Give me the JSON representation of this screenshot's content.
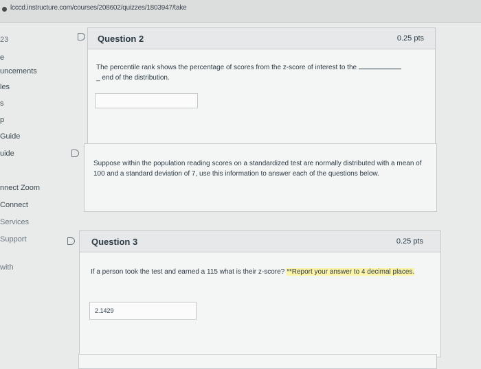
{
  "browser": {
    "url": "lcccd.instructure.com/courses/208602/quizzes/1803947/take"
  },
  "sidebar": {
    "items": [
      {
        "label": "23"
      },
      {
        "label": "e"
      },
      {
        "label": "uncements"
      },
      {
        "label": "les"
      },
      {
        "label": "s"
      },
      {
        "label": "p"
      },
      {
        "label": "Guide"
      },
      {
        "label": "uide"
      },
      {
        "label": "nnect Zoom"
      },
      {
        "label": "Connect"
      },
      {
        "label": "Services"
      },
      {
        "label": "Support"
      },
      {
        "label": "with"
      }
    ]
  },
  "questions": {
    "q2": {
      "title": "Question 2",
      "points": "0.25 pts",
      "text_before": "The percentile rank shows the percentage of scores from the z-score of interest to the",
      "text_after": "_ end of the distribution.",
      "answer_value": ""
    },
    "info": {
      "text": "Suppose within the population reading scores on a standardized test are normally distributed with a mean of 100 and a standard deviation of 7, use this information to answer each of the questions below."
    },
    "q3": {
      "title": "Question 3",
      "points": "0.25 pts",
      "text": "If a person took the test and earned a 115 what is their z-score?",
      "note": "**Report your answer to 4 decimal places.",
      "answer_value": "2.1429"
    }
  },
  "colors": {
    "background": "#e9eaea",
    "card": "#f4f5f5",
    "card_header": "#e6e8e9",
    "text": "#2d3b45",
    "highlight": "#fbf4a8"
  }
}
